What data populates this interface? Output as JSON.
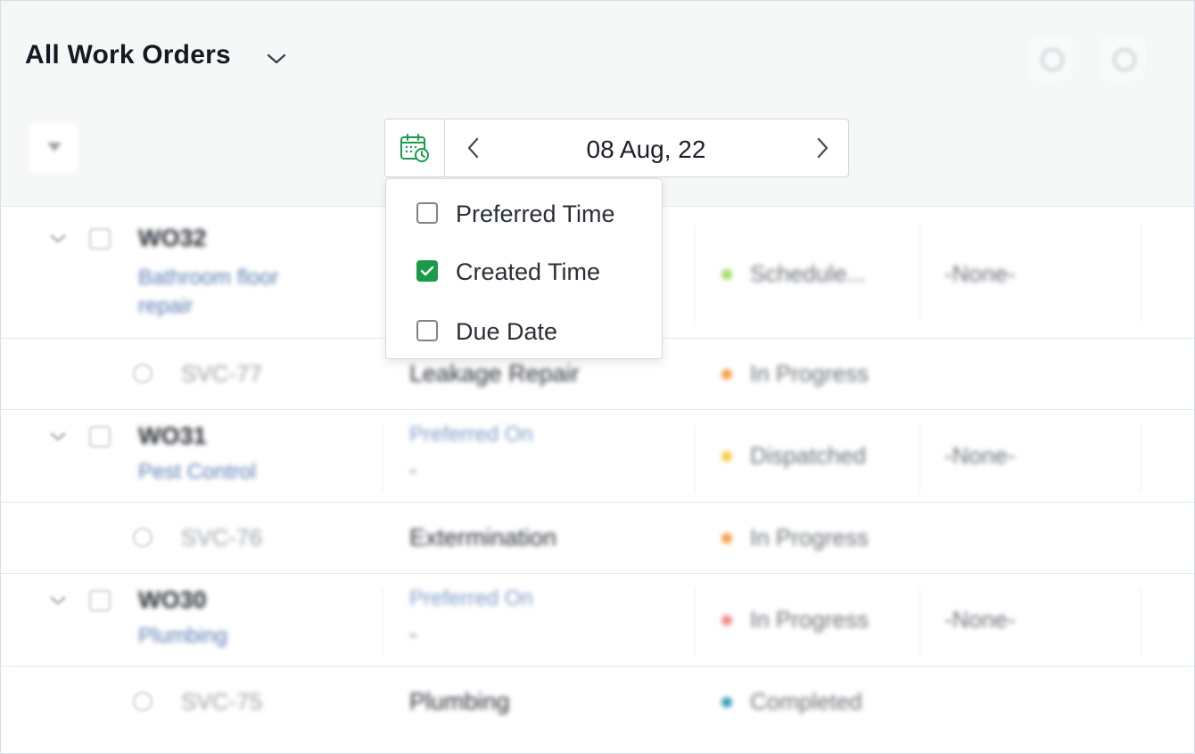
{
  "header": {
    "title": "All Work Orders",
    "title_dropdown_icon": "chevron-down-icon",
    "search_icon": "search-icon",
    "refresh_icon": "refresh-icon",
    "filter_icon": "filter-icon"
  },
  "date_picker": {
    "calendar_icon": "calendar-clock-icon",
    "prev_icon": "chevron-left-icon",
    "next_icon": "chevron-right-icon",
    "date": "08 Aug, 22"
  },
  "date_type_menu": {
    "items": [
      {
        "label": "Preferred Time",
        "checked": false
      },
      {
        "label": "Created Time",
        "checked": true
      },
      {
        "label": "Due Date",
        "checked": false
      }
    ]
  },
  "colors": {
    "accent_green": "#1a9b4b",
    "status_scheduled": "#a6d96a",
    "status_in_progress": "#f6a04d",
    "status_dispatched": "#f8cc4d",
    "status_in_progress_red": "#f28b8b",
    "status_completed": "#3aa3b8"
  },
  "table": {
    "rows": [
      {
        "kind": "parent",
        "id": "WO32",
        "subtitle": "Bathroom floor repair",
        "status": "Schedule...",
        "assignee": "-None-"
      },
      {
        "kind": "child",
        "id": "SVC-77",
        "service": "Leakage Repair",
        "status": "In Progress"
      },
      {
        "kind": "parent",
        "id": "WO31",
        "subtitle": "Pest Control",
        "preferred": "Preferred On",
        "preferred_value": "-",
        "status": "Dispatched",
        "assignee": "-None-"
      },
      {
        "kind": "child",
        "id": "SVC-76",
        "service": "Extermination",
        "status": "In Progress"
      },
      {
        "kind": "parent",
        "id": "WO30",
        "subtitle": "Plumbing",
        "preferred": "Preferred On",
        "preferred_value": "-",
        "status": "In Progress",
        "assignee": "-None-"
      },
      {
        "kind": "child",
        "id": "SVC-75",
        "service": "Plumbing",
        "status": "Completed"
      }
    ]
  }
}
